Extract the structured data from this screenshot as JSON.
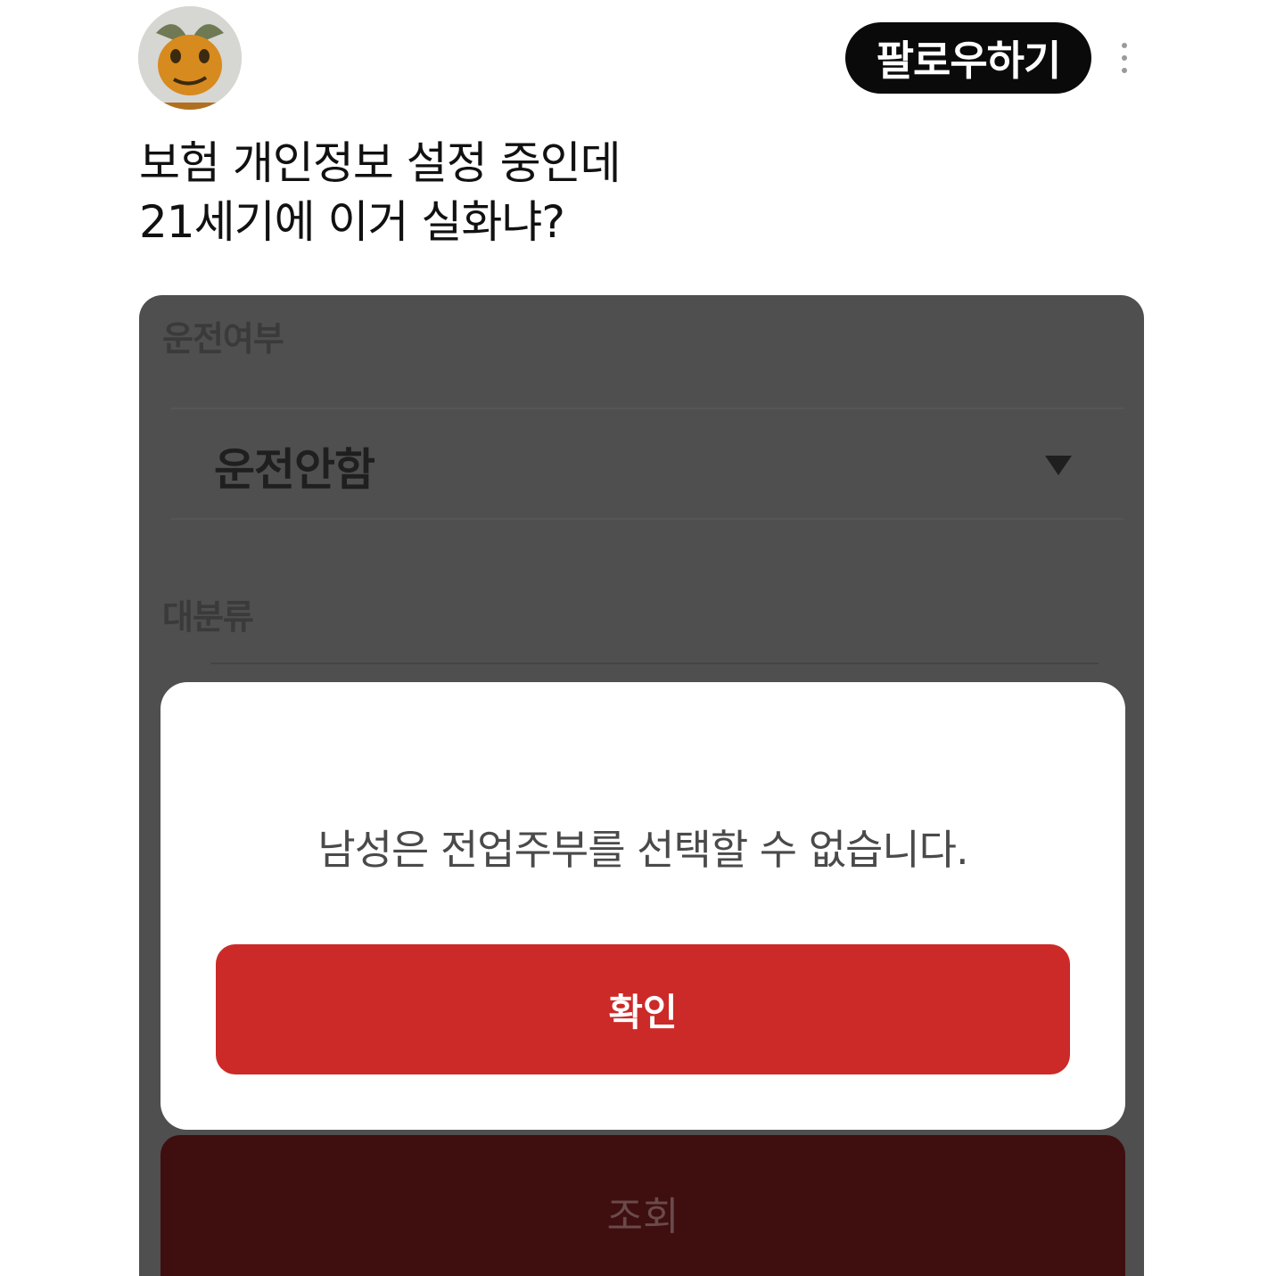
{
  "header": {
    "follow_label": "팔로우하기"
  },
  "post": {
    "line1": "보험 개인정보 설정 중인데",
    "line2": "21세기에 이거 실화냐?"
  },
  "form": {
    "driving_label": "운전여부",
    "driving_value": "운전안함",
    "category_label": "대분류"
  },
  "dialog": {
    "message": "남성은 전업주부를 선택할 수 없습니다.",
    "confirm_label": "확인"
  },
  "search_label": "조회",
  "colors": {
    "follow_bg": "#0a0a0a",
    "confirm_bg": "#cc2a28",
    "overlay_bg": "#4f4f4f",
    "search_bg": "#3f0e0e"
  }
}
